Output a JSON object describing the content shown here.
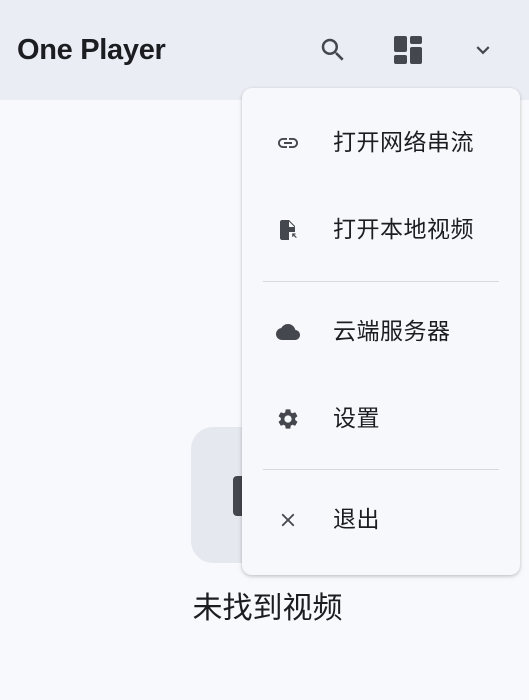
{
  "app_bar": {
    "title": "One Player",
    "actions": [
      {
        "icon": "search-icon"
      },
      {
        "icon": "dashboard-layout-icon"
      },
      {
        "icon": "chevron-down-icon"
      }
    ]
  },
  "empty_state": {
    "message": "未找到视频"
  },
  "menu": {
    "items": [
      {
        "label": "打开网络串流",
        "icon": "link-icon"
      },
      {
        "label": "打开本地视频",
        "icon": "file-open-icon"
      },
      {
        "label": "云端服务器",
        "icon": "cloud-icon"
      },
      {
        "label": "设置",
        "icon": "gear-icon"
      },
      {
        "label": "退出",
        "icon": "close-icon"
      }
    ]
  },
  "colors": {
    "app_bar_bg": "#eaedf4",
    "surface": "#f8f9fc",
    "icon": "#44474e",
    "text": "#1b1d21",
    "divider": "#d7d9df"
  }
}
